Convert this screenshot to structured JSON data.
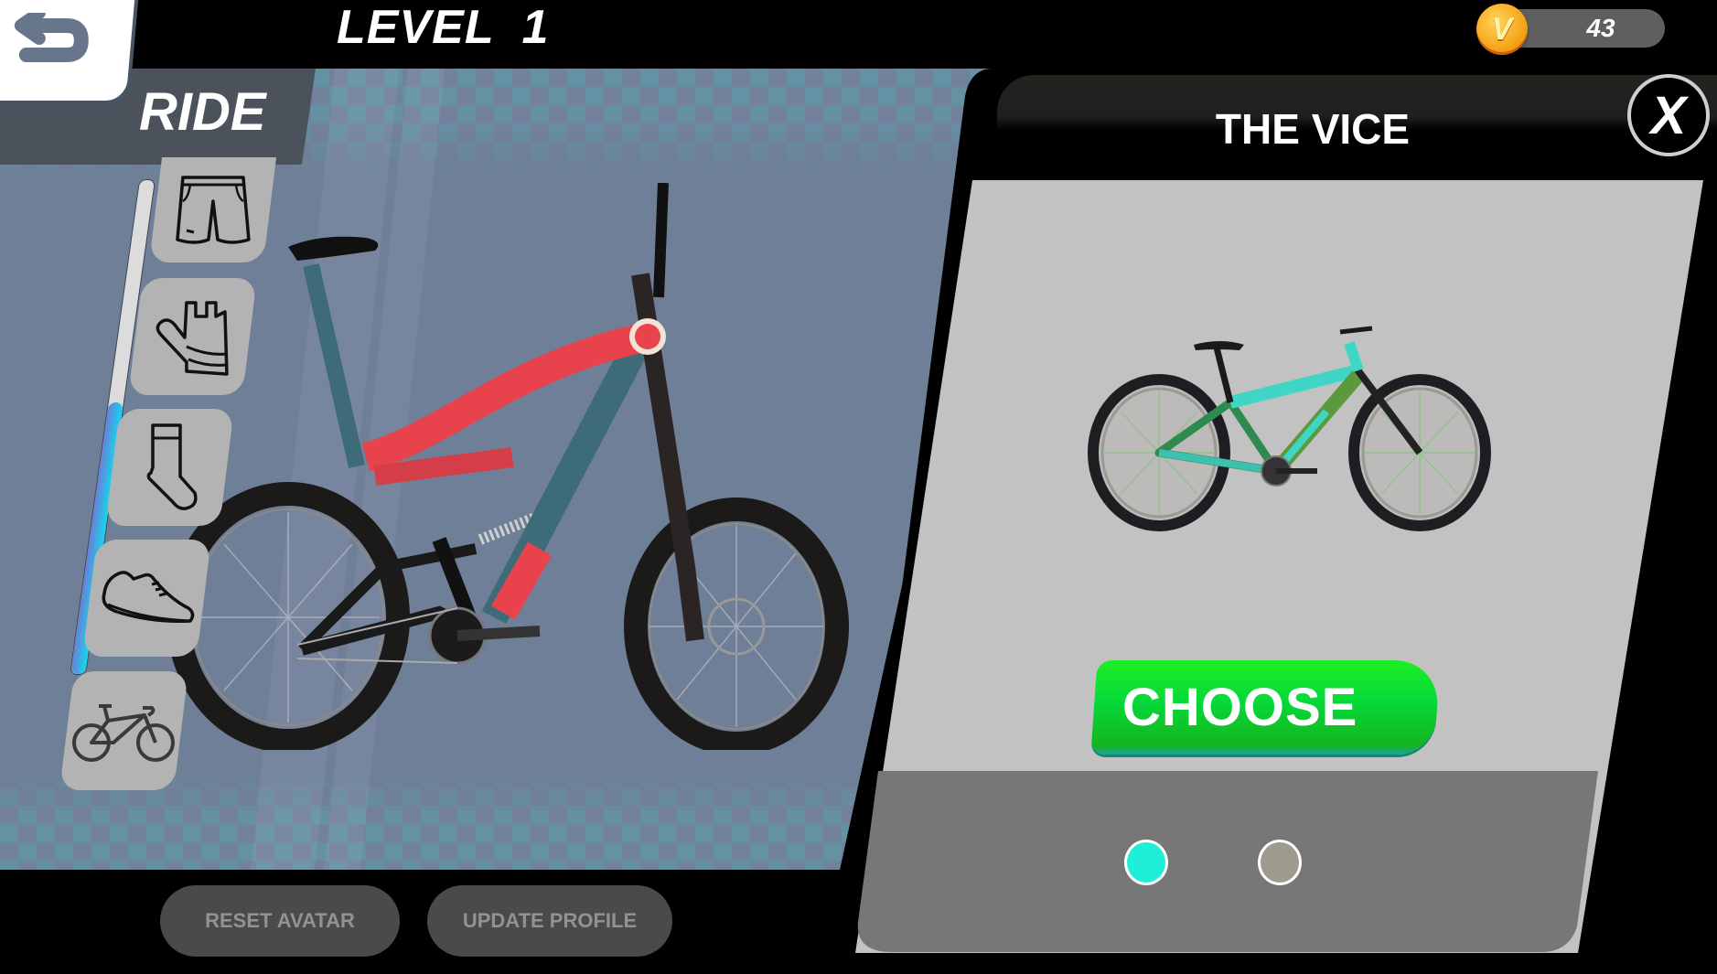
{
  "header": {
    "level_label": "LEVEL  1",
    "back_icon": "undo-arrow-icon",
    "currency": {
      "icon": "v-coin-icon",
      "coin_letter": "V",
      "amount": "43"
    }
  },
  "left_panel": {
    "tab_label": "RIDE",
    "scroll_position_pct": 55,
    "categories": [
      {
        "id": "shorts",
        "icon": "shorts-icon"
      },
      {
        "id": "gloves",
        "icon": "glove-icon"
      },
      {
        "id": "socks",
        "icon": "sock-icon"
      },
      {
        "id": "shoes",
        "icon": "shoe-icon"
      },
      {
        "id": "bike",
        "icon": "bicycle-icon"
      }
    ],
    "preview": {
      "description": "full-suspension mountain bike, red and teal frame"
    },
    "buttons": {
      "reset": "RESET AVATAR",
      "update": "UPDATE PROFILE"
    }
  },
  "detail_panel": {
    "title": "THE VICE",
    "close_label": "X",
    "item_preview": "hardtail mountain bike, teal and green frame",
    "choose_label": "CHOOSE",
    "colors": [
      {
        "name": "teal",
        "hex": "#1eefd6",
        "selected": true
      },
      {
        "name": "taupe",
        "hex": "#9e9b8c",
        "selected": false
      }
    ]
  },
  "theme": {
    "choose_green": "#06d83a",
    "slider_fill_start": "#6a7fd8",
    "slider_fill_end": "#11d8ef",
    "panel_gray": "#c2c2c2",
    "panel_dark_gray": "#777777"
  }
}
